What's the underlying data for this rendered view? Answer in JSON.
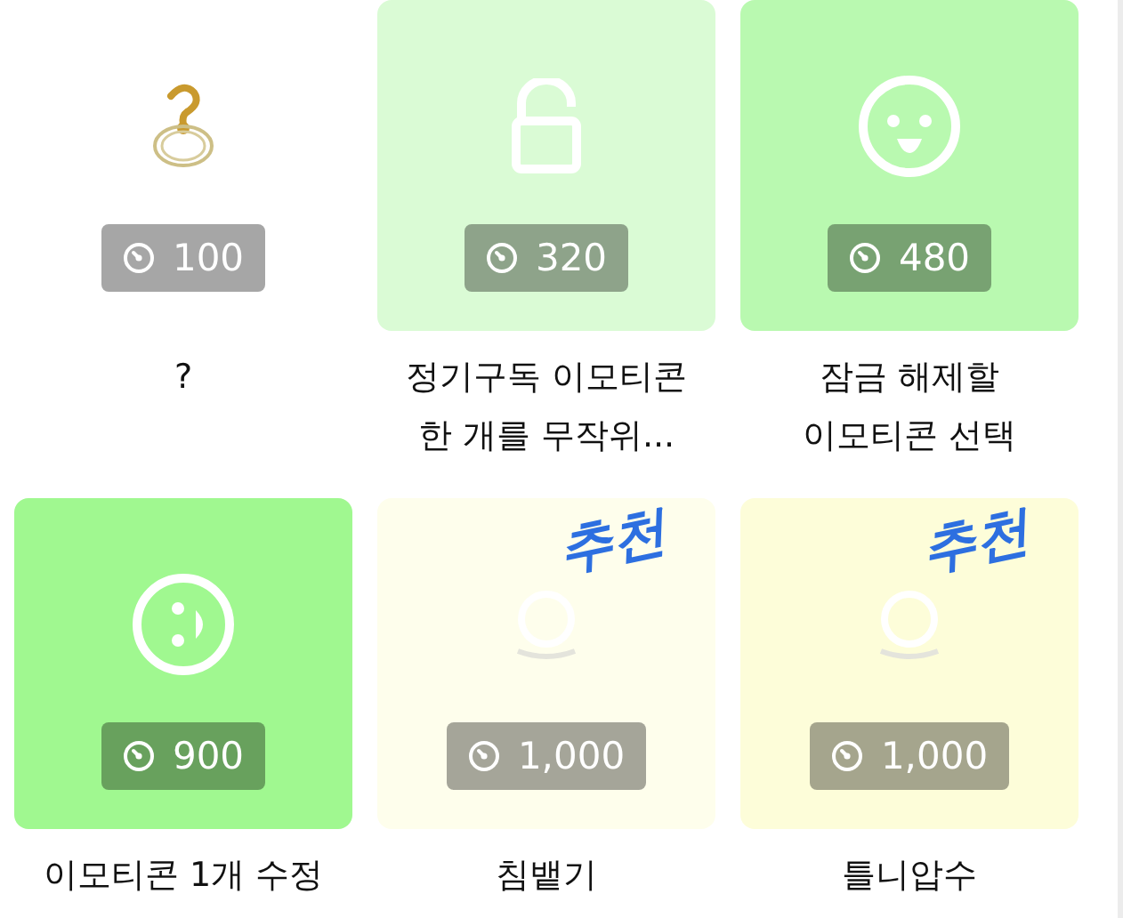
{
  "items": [
    {
      "kind": "mystery",
      "color": "#ffffff",
      "price": "100",
      "label": "?"
    },
    {
      "kind": "unlock",
      "color": "#dafbd5",
      "price": "320",
      "label": "정기구독 이모티콘 한 개를 무작위..."
    },
    {
      "kind": "smile",
      "color": "#b9f9b0",
      "price": "480",
      "label": "잠금 해제할 이모티콘 선택"
    },
    {
      "kind": "wink",
      "color": "#a0f890",
      "price": "900",
      "label": "이모티콘 1개 수정"
    },
    {
      "kind": "spit",
      "color": "#fefeec",
      "price": "1,000",
      "label": "침뱉기",
      "badge": "추천"
    },
    {
      "kind": "denture",
      "color": "#fdfdd9",
      "price": "1,000",
      "label": "틀니압수",
      "badge": "추천"
    }
  ]
}
